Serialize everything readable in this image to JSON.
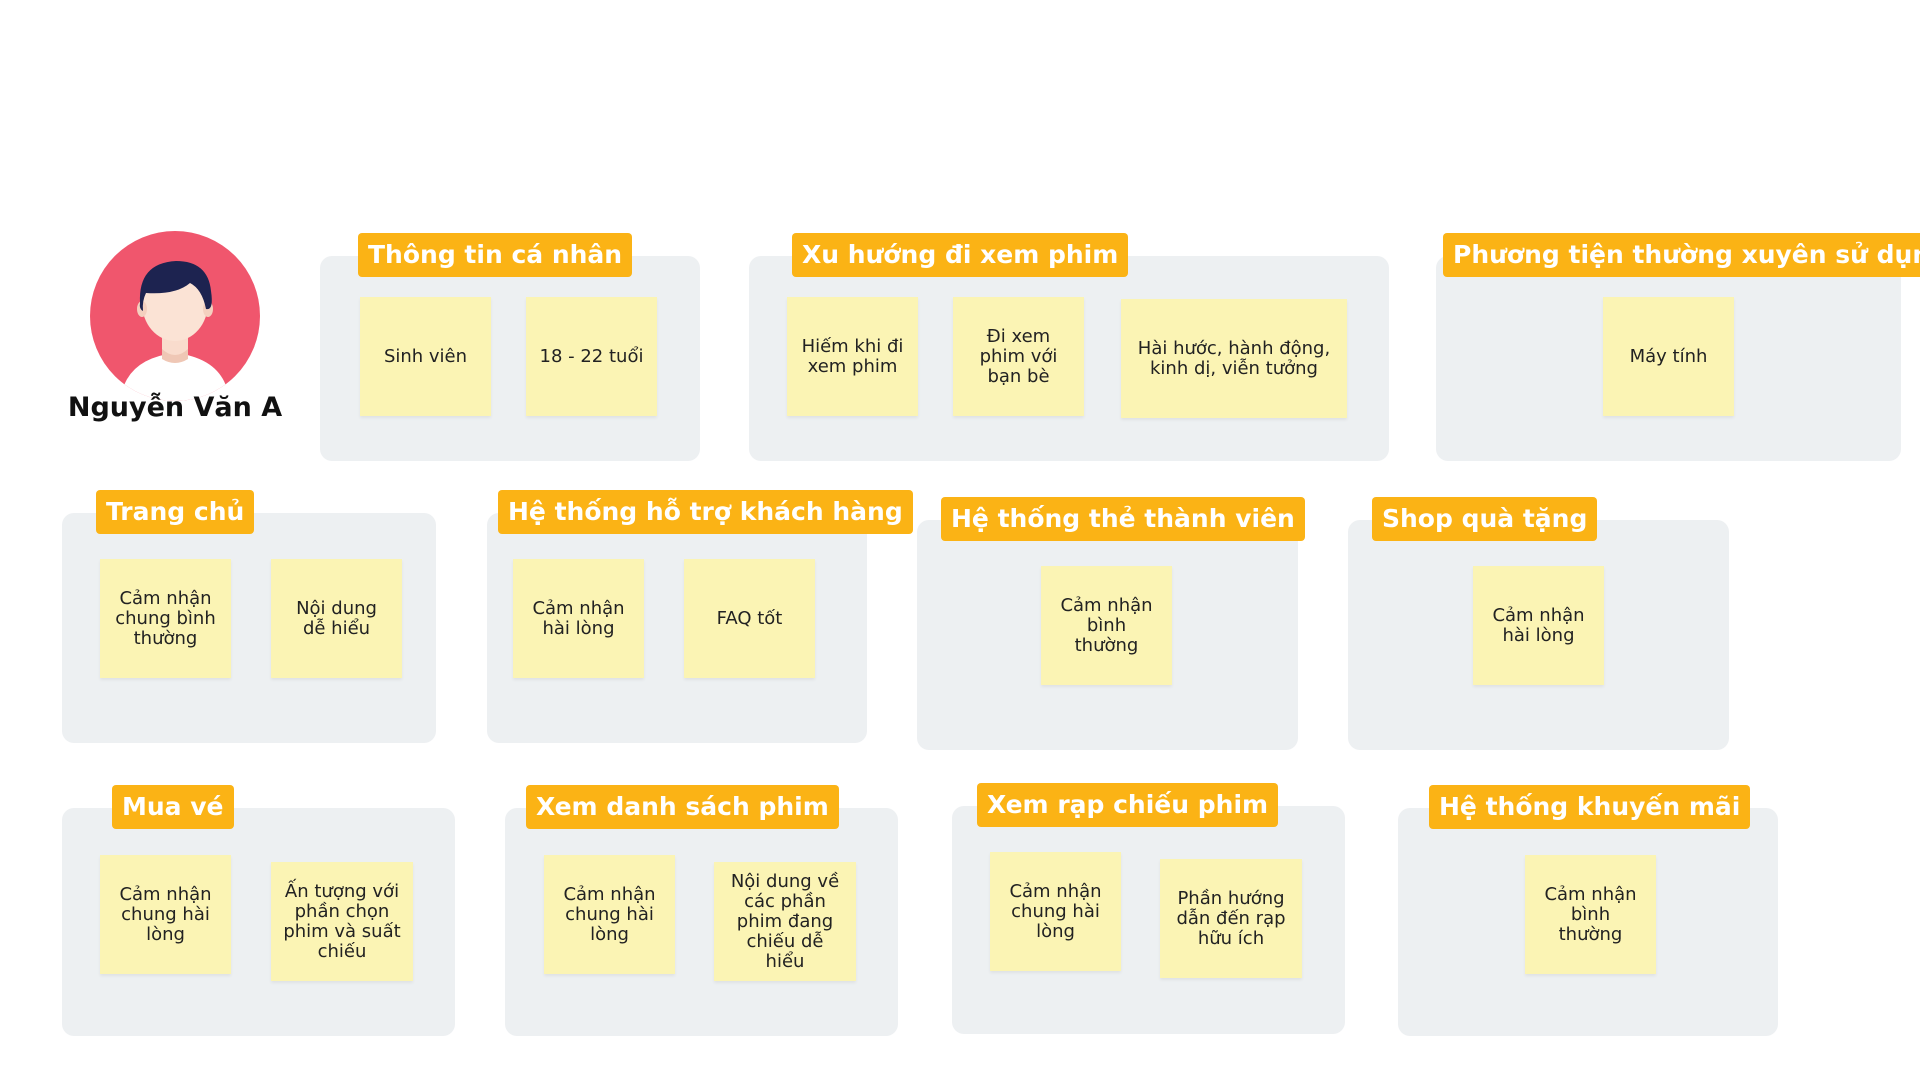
{
  "persona": {
    "name": "Nguyễn Văn A",
    "avatar_icon": "person-avatar-icon",
    "avatar_bg": "#f0566d"
  },
  "colors": {
    "tag": "#fbb315",
    "panel": "#edf0f2",
    "note": "#fbf4b4"
  },
  "sections": {
    "personal": {
      "title": "Thông tin cá nhân",
      "notes": [
        "Sinh viên",
        "18 - 22 tuổi"
      ]
    },
    "trend": {
      "title": "Xu hướng đi xem phim",
      "notes": [
        "Hiếm khi đi xem phim",
        "Đi xem phim với bạn bè",
        "Hài hước, hành động, kinh dị, viễn tưởng"
      ]
    },
    "device": {
      "title": "Phương tiện thường xuyên sử dụng",
      "notes": [
        "Máy tính"
      ]
    },
    "home": {
      "title": "Trang chủ",
      "notes": [
        "Cảm nhận chung bình thường",
        "Nội dung dễ hiểu"
      ]
    },
    "support": {
      "title": "Hệ thống hỗ trợ khách hàng",
      "notes": [
        "Cảm nhận hài lòng",
        "FAQ tốt"
      ]
    },
    "membership": {
      "title": "Hệ thống thẻ thành viên",
      "notes": [
        "Cảm nhận bình thường"
      ]
    },
    "giftshop": {
      "title": "Shop quà tặng",
      "notes": [
        "Cảm nhận hài lòng"
      ]
    },
    "tickets": {
      "title": "Mua vé",
      "notes": [
        "Cảm nhận chung hài lòng",
        "Ấn tượng với phần chọn phim và suất chiếu"
      ]
    },
    "movielist": {
      "title": "Xem danh sách phim",
      "notes": [
        "Cảm nhận chung hài lòng",
        "Nội dung về các phần phim đang chiếu dễ hiểu"
      ]
    },
    "cinemas": {
      "title": "Xem rạp chiếu phim",
      "notes": [
        "Cảm nhận chung hài lòng",
        "Phần hướng dẫn đến rạp hữu ích"
      ]
    },
    "promotions": {
      "title": "Hệ thống khuyến mãi",
      "notes": [
        "Cảm nhận bình thường"
      ]
    }
  }
}
